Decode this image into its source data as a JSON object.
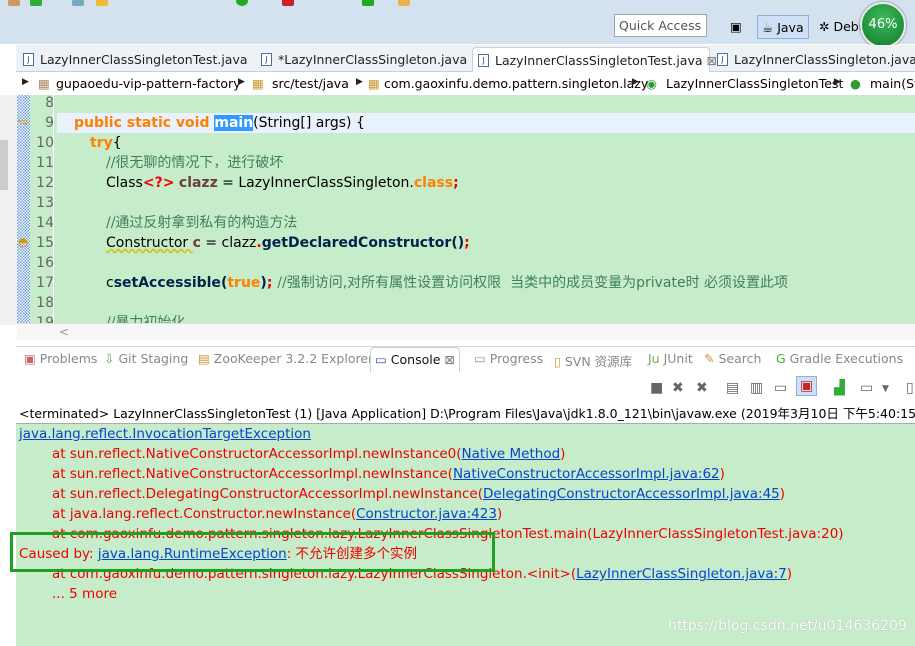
{
  "toolbar": {
    "quick_access": "Quick Access",
    "perspectives": [
      "Java",
      "Debug"
    ],
    "memory_gauge": "46%"
  },
  "editor_tabs": [
    {
      "label": "LazyInnerClassSingletonTest.java",
      "active": false
    },
    {
      "label": "*LazyInnerClassSingleton.java",
      "active": false
    },
    {
      "label": "LazyInnerClassSingletonTest.java",
      "active": true,
      "close": "⊠"
    },
    {
      "label": "LazyInnerClassSingleton.java",
      "active": false
    }
  ],
  "breadcrumb": [
    "gupaoedu-vip-pattern-factory",
    "src/test/java",
    "com.gaoxinfu.demo.pattern.singleton.lazy",
    "LazyInnerClassSingletonTest",
    "main(Str"
  ],
  "editor": {
    "line_numbers": [
      "8",
      "9",
      "10",
      "11",
      "12",
      "13",
      "14",
      "15",
      "16",
      "17",
      "18",
      "19"
    ],
    "code": {
      "l9a": "public static void ",
      "l9b": "main",
      "l9c": "(String[] args) {",
      "l10a": "try",
      "l10b": "{",
      "l11": "//很无聊的情况下，进行破坏",
      "l12a": "Class",
      "l12b": "<?>",
      "l12c": "clazz",
      "l12d": " = LazyInnerClassSingleton.",
      "l12e": "class",
      "l14": "//通过反射拿到私有的构造方法",
      "l15a": "Constructor ",
      "l15b": "c",
      "l15c": " = ",
      "l15d": "clazz",
      "l15e": ".",
      "l15f": "getDeclaredConstructor",
      "l15g": "()",
      "l17a": "c",
      ".": ".",
      "l17b": "setAccessible",
      "l17c": "(",
      "l17d": "true",
      "l17e": ")",
      "l17f": "; ",
      "l17g": "//强制访问,对所有属性设置访问权限  当类中的成员变量为private时 必须设置此项",
      "l19": "//暴力初始化"
    }
  },
  "panel_tabs": [
    "Problems",
    "Git Staging",
    "ZooKeeper 3.2.2 Explorer",
    "Console",
    "Progress",
    "SVN 资源库",
    "JUnit",
    "Search",
    "Gradle Executions"
  ],
  "console": {
    "header": "<terminated> LazyInnerClassSingletonTest (1) [Java Application] D:\\Program Files\\Java\\jdk1.8.0_121\\bin\\javaw.exe (2019年3月10日 下午5:40:15)",
    "lines": [
      {
        "text": "",
        "link": "java.lang.reflect.InvocationTargetException",
        "after": ""
      },
      {
        "text": "at sun.reflect.NativeConstructorAccessorImpl.newInstance0(",
        "link": "Native Method",
        "after": ")"
      },
      {
        "text": "at sun.reflect.NativeConstructorAccessorImpl.newInstance(",
        "link": "NativeConstructorAccessorImpl.java:62",
        "after": ")"
      },
      {
        "text": "at sun.reflect.DelegatingConstructorAccessorImpl.newInstance(",
        "link": "DelegatingConstructorAccessorImpl.java:45",
        "after": ")"
      },
      {
        "text": "at java.lang.reflect.Constructor.newInstance(",
        "link": "Constructor.java:423",
        "after": ")"
      },
      {
        "text": "at com.gaoxinfu.demo.pattern.singleton.lazy.LazyInnerClassSingletonTest.main(",
        "link": "",
        "after": "LazyInnerClassSingletonTest.java:20)"
      },
      {
        "text": "Caused by: ",
        "link": "java.lang.RuntimeException",
        "after": ": 不允许创建多个实例"
      },
      {
        "text": "at com.gaoxinfu.demo.pattern.singleton.lazy.LazyInnerClassSingleton.<init>(",
        "link": "LazyInnerClassSingleton.java:7",
        "after": ")"
      },
      {
        "text": "... 5 more",
        "link": "",
        "after": ""
      }
    ]
  },
  "watermark": "https://blog.csdn.net/u014636209"
}
